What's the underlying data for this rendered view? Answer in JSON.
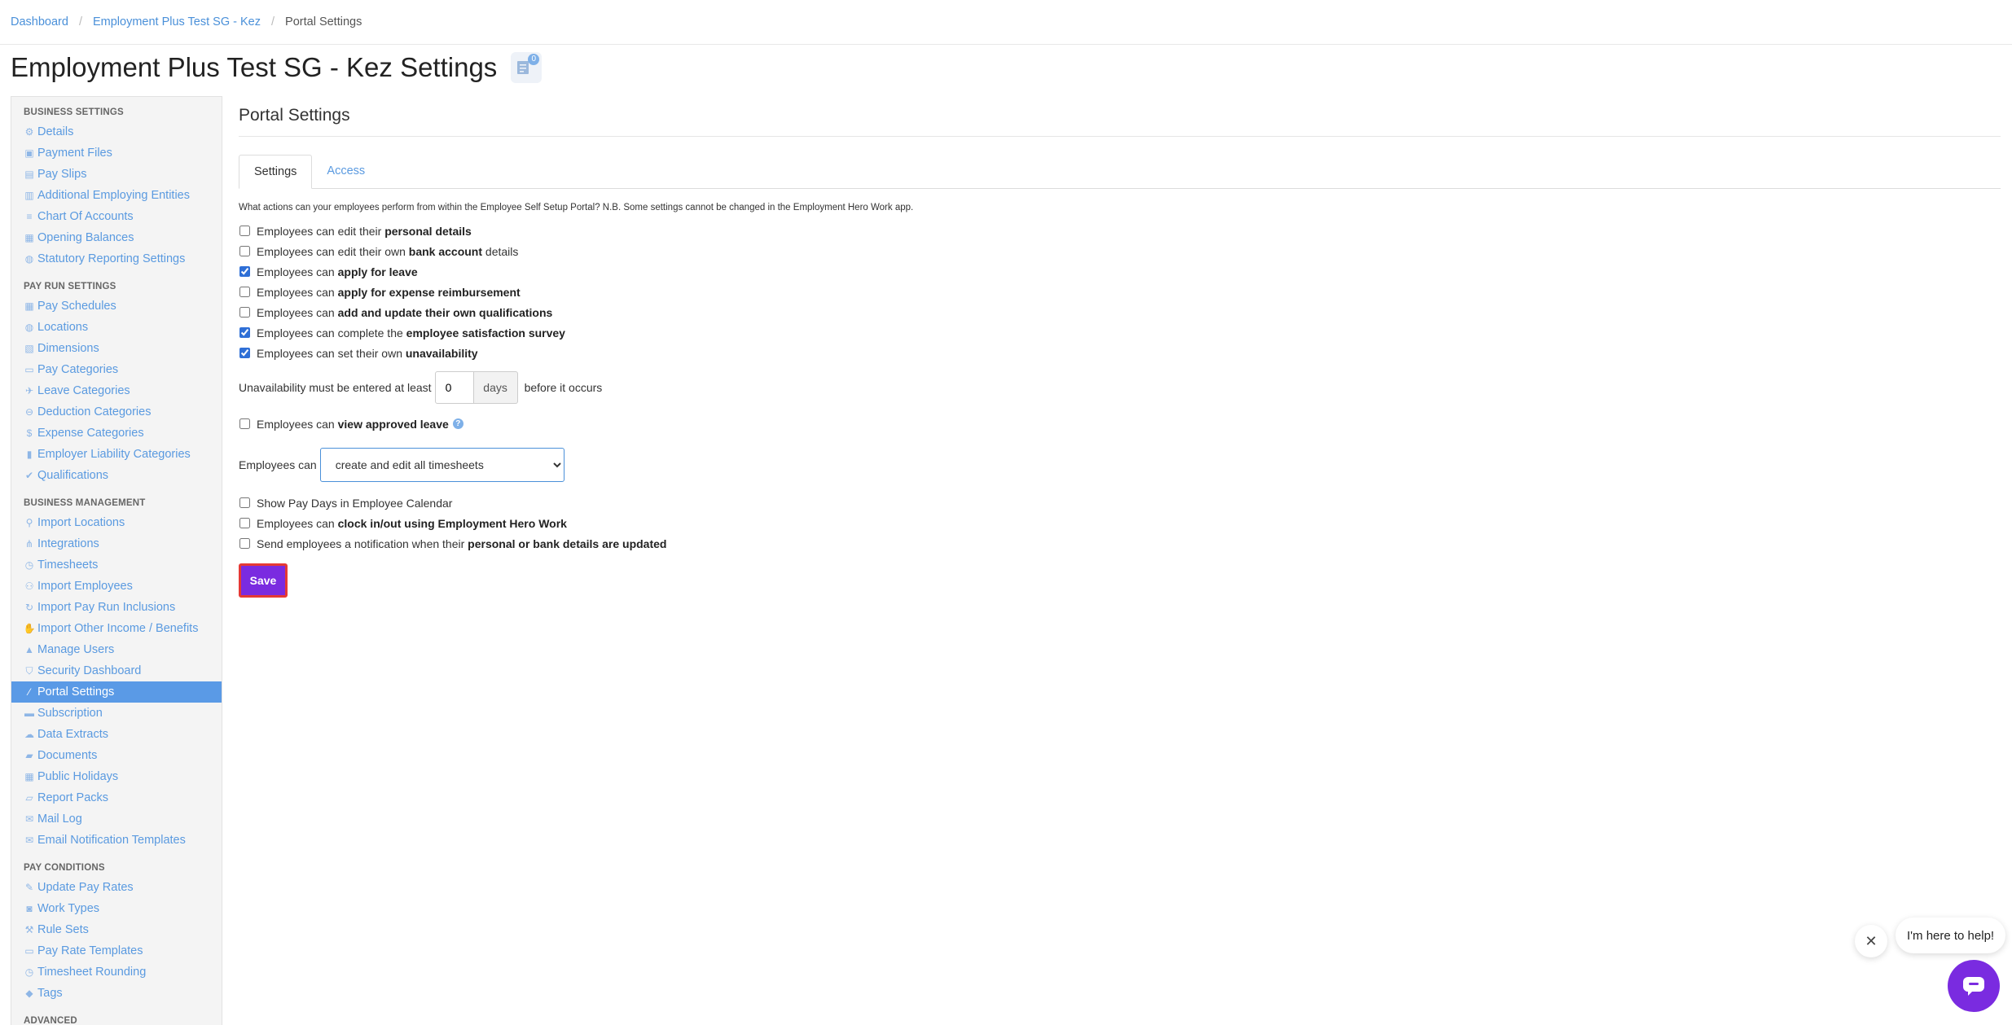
{
  "breadcrumb": {
    "items": [
      "Dashboard",
      "Employment Plus Test SG - Kez"
    ],
    "current": "Portal Settings"
  },
  "page": {
    "title": "Employment Plus Test SG - Kez Settings",
    "badge_count": "0"
  },
  "sidebar": {
    "sections": [
      {
        "title": "BUSINESS SETTINGS",
        "items": [
          {
            "label": "Details",
            "icon": "gear-icon"
          },
          {
            "label": "Payment Files",
            "icon": "save-icon"
          },
          {
            "label": "Pay Slips",
            "icon": "file-icon"
          },
          {
            "label": "Additional Employing Entities",
            "icon": "bank-icon"
          },
          {
            "label": "Chart Of Accounts",
            "icon": "list-icon"
          },
          {
            "label": "Opening Balances",
            "icon": "book-icon"
          },
          {
            "label": "Statutory Reporting Settings",
            "icon": "globe-icon"
          }
        ]
      },
      {
        "title": "PAY RUN SETTINGS",
        "items": [
          {
            "label": "Pay Schedules",
            "icon": "calendar-icon"
          },
          {
            "label": "Locations",
            "icon": "globe-icon"
          },
          {
            "label": "Dimensions",
            "icon": "dimension-icon"
          },
          {
            "label": "Pay Categories",
            "icon": "money-icon"
          },
          {
            "label": "Leave Categories",
            "icon": "plane-icon"
          },
          {
            "label": "Deduction Categories",
            "icon": "minus-circle-icon"
          },
          {
            "label": "Expense Categories",
            "icon": "dollar-icon"
          },
          {
            "label": "Employer Liability Categories",
            "icon": "bar-chart-icon"
          },
          {
            "label": "Qualifications",
            "icon": "check-icon"
          }
        ]
      },
      {
        "title": "BUSINESS MANAGEMENT",
        "items": [
          {
            "label": "Import Locations",
            "icon": "pin-icon"
          },
          {
            "label": "Integrations",
            "icon": "integrations-icon"
          },
          {
            "label": "Timesheets",
            "icon": "clock-icon"
          },
          {
            "label": "Import Employees",
            "icon": "people-icon"
          },
          {
            "label": "Import Pay Run Inclusions",
            "icon": "refresh-icon"
          },
          {
            "label": "Import Other Income / Benefits",
            "icon": "hand-icon"
          },
          {
            "label": "Manage Users",
            "icon": "lock-icon"
          },
          {
            "label": "Security Dashboard",
            "icon": "shield-icon"
          },
          {
            "label": "Portal Settings",
            "icon": "magic-icon",
            "active": true
          },
          {
            "label": "Subscription",
            "icon": "card-icon"
          },
          {
            "label": "Data Extracts",
            "icon": "cloud-icon"
          },
          {
            "label": "Documents",
            "icon": "folder-icon"
          },
          {
            "label": "Public Holidays",
            "icon": "calendar-icon"
          },
          {
            "label": "Report Packs",
            "icon": "folder-open-icon"
          },
          {
            "label": "Mail Log",
            "icon": "mail-icon"
          },
          {
            "label": "Email Notification Templates",
            "icon": "envelope-icon"
          }
        ]
      },
      {
        "title": "PAY CONDITIONS",
        "items": [
          {
            "label": "Update Pay Rates",
            "icon": "edit-icon"
          },
          {
            "label": "Work Types",
            "icon": "camera-icon"
          },
          {
            "label": "Rule Sets",
            "icon": "gavel-icon"
          },
          {
            "label": "Pay Rate Templates",
            "icon": "money-icon"
          },
          {
            "label": "Timesheet Rounding",
            "icon": "clock-icon"
          },
          {
            "label": "Tags",
            "icon": "tag-icon"
          }
        ]
      },
      {
        "title": "ADVANCED",
        "items": []
      }
    ]
  },
  "main": {
    "section_title": "Portal Settings",
    "tabs": [
      {
        "label": "Settings",
        "active": true
      },
      {
        "label": "Access",
        "active": false
      }
    ],
    "intro": "What actions can your employees perform from within the Employee Self Setup Portal? N.B. Some settings cannot be changed in the Employment Hero Work app.",
    "checkboxes_top": [
      {
        "pre": "Employees can edit their ",
        "bold": "personal details",
        "post": "",
        "checked": false
      },
      {
        "pre": "Employees can edit their own ",
        "bold": "bank account",
        "post": " details",
        "checked": false
      },
      {
        "pre": "Employees can ",
        "bold": "apply for leave",
        "post": "",
        "checked": true
      },
      {
        "pre": "Employees can ",
        "bold": "apply for expense reimbursement",
        "post": "",
        "checked": false
      },
      {
        "pre": "Employees can ",
        "bold": "add and update their own qualifications",
        "post": "",
        "checked": false
      },
      {
        "pre": "Employees can complete the ",
        "bold": "employee satisfaction survey",
        "post": "",
        "checked": true
      },
      {
        "pre": "Employees can set their own ",
        "bold": "unavailability",
        "post": "",
        "checked": true
      }
    ],
    "unavailability": {
      "label_before": "Unavailability must be entered at least",
      "value": "0",
      "unit": "days",
      "label_after": "before it occurs"
    },
    "view_leave": {
      "pre": "Employees can ",
      "bold": "view approved leave",
      "checked": false
    },
    "employees_can": {
      "label": "Employees can",
      "selected": "create and edit all timesheets"
    },
    "checkboxes_bottom": [
      {
        "pre": "Show Pay Days in Employee Calendar",
        "bold": "",
        "post": "",
        "checked": false
      },
      {
        "pre": "Employees can ",
        "bold": "clock in/out using Employment Hero Work",
        "post": "",
        "checked": false
      },
      {
        "pre": "Send employees a notification when their ",
        "bold": "personal or bank details are updated",
        "post": "",
        "checked": false
      }
    ],
    "save_label": "Save"
  },
  "chat": {
    "message": "I'm here to help!"
  },
  "colors": {
    "accent": "#5a9ae6",
    "save": "#7a2be0",
    "link": "#4a90d9"
  }
}
